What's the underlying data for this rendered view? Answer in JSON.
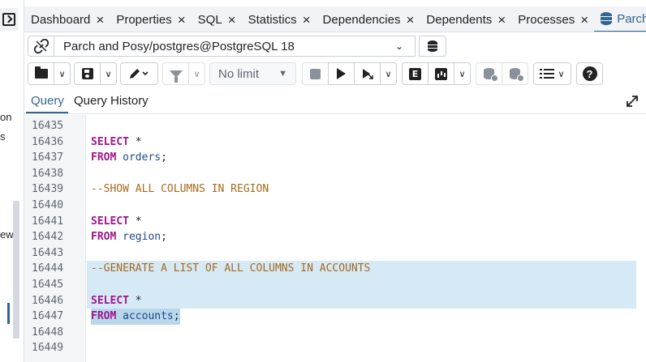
{
  "left_panel": {
    "fragments": [
      "on",
      "s",
      "ew"
    ]
  },
  "tabs": [
    {
      "label": "Dashboard",
      "active": false
    },
    {
      "label": "Properties",
      "active": false
    },
    {
      "label": "SQL",
      "active": false
    },
    {
      "label": "Statistics",
      "active": false
    },
    {
      "label": "Dependencies",
      "active": false
    },
    {
      "label": "Dependents",
      "active": false
    },
    {
      "label": "Processes",
      "active": false
    },
    {
      "label": "Parch and",
      "active": true,
      "icon": "database-icon"
    }
  ],
  "connection": {
    "label": "Parch and Posy/postgres@PostgreSQL 18"
  },
  "toolbar": {
    "limit_label": "No limit",
    "help_label": "?",
    "explain_label": "E"
  },
  "subtabs": {
    "query": "Query",
    "history": "Query History"
  },
  "editor": {
    "lines": [
      {
        "number": "16435",
        "text": ""
      },
      {
        "number": "16436",
        "text": "SELECT *"
      },
      {
        "number": "16437",
        "text": "FROM orders;"
      },
      {
        "number": "16438",
        "text": ""
      },
      {
        "number": "16439",
        "text": "--SHOW ALL COLUMNS IN REGION"
      },
      {
        "number": "16440",
        "text": ""
      },
      {
        "number": "16441",
        "text": "SELECT *"
      },
      {
        "number": "16442",
        "text": "FROM region;"
      },
      {
        "number": "16443",
        "text": ""
      },
      {
        "number": "16444",
        "text": "--GENERATE A LIST OF ALL COLUMNS IN ACCOUNTS"
      },
      {
        "number": "16445",
        "text": ""
      },
      {
        "number": "16446",
        "text": "SELECT *"
      },
      {
        "number": "16447",
        "text": "FROM accounts;"
      },
      {
        "number": "16448",
        "text": ""
      },
      {
        "number": "16449",
        "text": ""
      }
    ],
    "tokens": {
      "select": "SELECT",
      "star": "*",
      "from": "FROM",
      "orders": "orders",
      "region": "region",
      "accounts": "accounts",
      "semicolon": ";",
      "comment_region": "--SHOW ALL COLUMNS IN REGION",
      "comment_accounts": "--GENERATE A LIST OF ALL COLUMNS IN ACCOUNTS"
    }
  },
  "colors": {
    "accent": "#326690",
    "keyword": "#a0178c",
    "identifier": "#1c4a8c",
    "comment": "#a66a1b",
    "highlight": "#d6eaf6"
  }
}
